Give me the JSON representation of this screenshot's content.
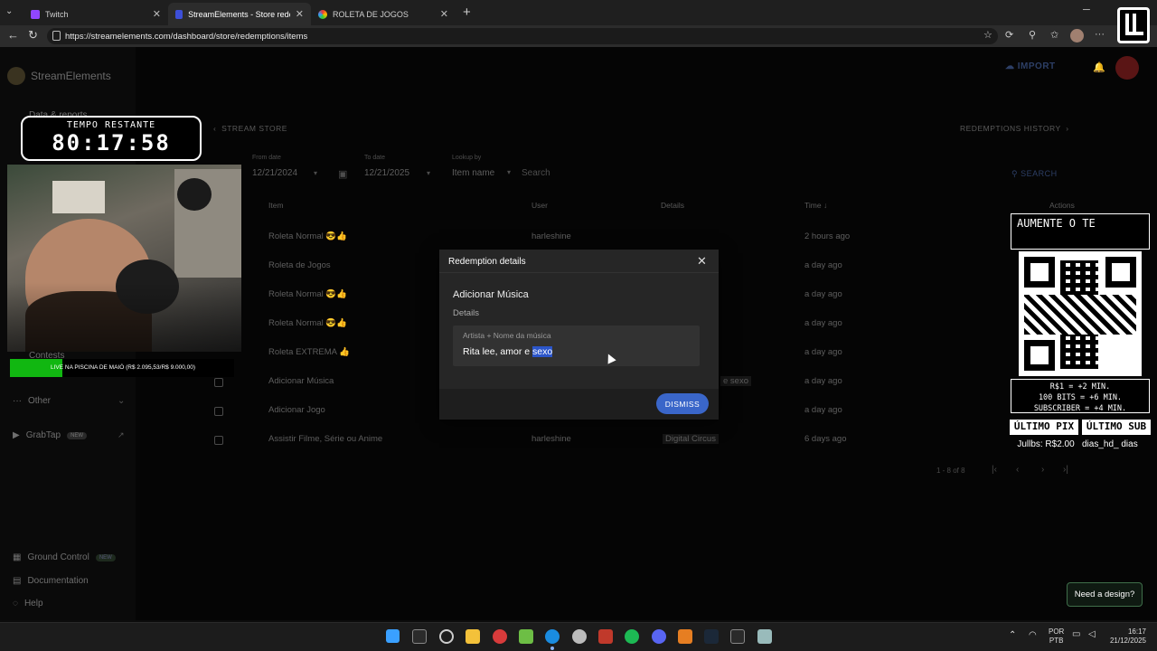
{
  "browser": {
    "tabs": [
      {
        "label": "Twitch",
        "active": false
      },
      {
        "label": "StreamElements - Store redemptio",
        "active": true
      },
      {
        "label": "ROLETA DE JOGOS",
        "active": false
      }
    ],
    "url": "https://streamelements.com/dashboard/store/redemptions/items"
  },
  "app": {
    "brand": "StreamElements",
    "import_label": "IMPORT",
    "sidebar": {
      "top_item": "Data & reports",
      "other": "Other",
      "contests": "Contests",
      "grabtap": "GrabTap",
      "grabtap_badge": "NEW",
      "ground_control": "Ground Control",
      "ground_control_badge": "NEW",
      "documentation": "Documentation",
      "help": "Help"
    },
    "back_label": "STREAM STORE",
    "history_label": "REDEMPTIONS HISTORY",
    "filters": {
      "from_label": "From date",
      "from_value": "12/21/2024",
      "to_label": "To date",
      "to_value": "12/21/2025",
      "lookup_label": "Lookup by",
      "lookup_value": "Item name",
      "search_placeholder": "Search",
      "search_button": "SEARCH"
    },
    "table": {
      "columns": [
        "Item",
        "User",
        "Details",
        "Time",
        "Actions"
      ],
      "rows": [
        {
          "item": "Roleta Normal 😎👍",
          "user": "harleshine",
          "details": "",
          "time": "2 hours ago"
        },
        {
          "item": "Roleta de Jogos",
          "user": "",
          "details": "",
          "time": "a day ago"
        },
        {
          "item": "Roleta Normal 😎👍",
          "user": "",
          "details": "",
          "time": "a day ago"
        },
        {
          "item": "Roleta Normal 😎👍",
          "user": "",
          "details": "",
          "time": "a day ago"
        },
        {
          "item": "Roleta EXTREMA 👍",
          "user": "",
          "details": "",
          "time": "a day ago"
        },
        {
          "item": "Adicionar Música",
          "user": "",
          "details": "e sexo",
          "time": "a day ago"
        },
        {
          "item": "Adicionar Jogo",
          "user": "",
          "details": "",
          "time": "a day ago"
        },
        {
          "item": "Assistir Filme, Série ou Anime",
          "user": "harleshine",
          "details": "Digital Circus",
          "time": "6 days ago"
        }
      ],
      "pagination": "1 - 8 of 8"
    },
    "need_design": "Need a design?"
  },
  "modal": {
    "title": "Redemption details",
    "item_name": "Adicionar Música",
    "details_label": "Details",
    "field_label": "Artista + Nome da música",
    "field_value_plain": "Rita lee, amor e ",
    "field_value_selected": "sexo",
    "dismiss": "DISMISS"
  },
  "overlay": {
    "timer_label": "TEMPO RESTANTE",
    "timer_value": "80:17:58",
    "live_text": "LIVE NA PISCINA DE MAIÓ (R$ 2.095,53/R$ 9.000,00)",
    "live_progress": 0.233,
    "promo_title": "AUMENTE O TE",
    "rates": [
      "R$1 = +2 MIN.",
      "100 BITS = +6 MIN.",
      "SUBSCRIBER = +4 MIN."
    ],
    "last_pix_label": "ÚLTIMO PIX",
    "last_pix_value": "Jullbs: R$2.00",
    "last_sub_label": "ÚLTIMO SUB",
    "last_sub_value": "dias_hd_ dias"
  },
  "taskbar": {
    "lang": "POR",
    "layout": "PTB",
    "time": "16:17",
    "date": "21/12/2025"
  }
}
